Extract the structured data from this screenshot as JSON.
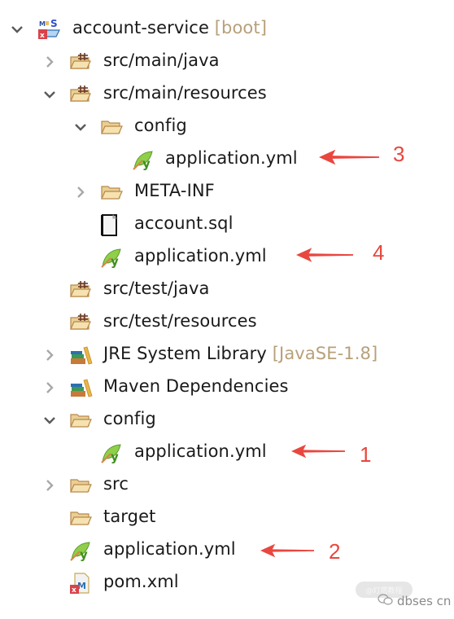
{
  "tree": {
    "root": {
      "label": "account-service",
      "decoration": "[boot]",
      "expanded": true,
      "icon": "maven-spring-project-icon"
    },
    "items": [
      {
        "label": "src/main/java",
        "icon": "package-folder-icon",
        "expandable": true,
        "expanded": false
      },
      {
        "label": "src/main/resources",
        "icon": "package-folder-icon",
        "expandable": true,
        "expanded": true
      },
      {
        "label": "config",
        "icon": "folder-open-icon",
        "expandable": true,
        "expanded": true
      },
      {
        "label": "application.yml",
        "icon": "spring-yaml-icon"
      },
      {
        "label": "META-INF",
        "icon": "folder-open-icon",
        "expandable": true,
        "expanded": false
      },
      {
        "label": "account.sql",
        "icon": "text-file-icon"
      },
      {
        "label": "application.yml",
        "icon": "spring-yaml-icon"
      },
      {
        "label": "src/test/java",
        "icon": "package-folder-icon"
      },
      {
        "label": "src/test/resources",
        "icon": "package-folder-icon"
      },
      {
        "label": "JRE System Library",
        "decoration": "[JavaSE-1.8]",
        "icon": "library-icon",
        "expandable": true,
        "expanded": false
      },
      {
        "label": "Maven Dependencies",
        "icon": "library-icon",
        "expandable": true,
        "expanded": false
      },
      {
        "label": "config",
        "icon": "folder-open-icon",
        "expandable": true,
        "expanded": true
      },
      {
        "label": "application.yml",
        "icon": "spring-yaml-icon"
      },
      {
        "label": "src",
        "icon": "folder-open-icon",
        "expandable": true,
        "expanded": false
      },
      {
        "label": "target",
        "icon": "folder-open-icon"
      },
      {
        "label": "application.yml",
        "icon": "spring-yaml-icon"
      },
      {
        "label": "pom.xml",
        "icon": "maven-pom-icon"
      }
    ]
  },
  "annotations": [
    {
      "number": "3",
      "target": "config/application.yml (src/main/resources)"
    },
    {
      "number": "4",
      "target": "application.yml (src/main/resources)"
    },
    {
      "number": "1",
      "target": "config/application.yml (project root)"
    },
    {
      "number": "2",
      "target": "application.yml (project root)"
    }
  ],
  "watermark": {
    "badge": "@灯塔教程",
    "text": "dbses cn"
  },
  "colors": {
    "arrow": "#e8473f",
    "decoration": "#b8a07a",
    "text": "#1a1a1a"
  }
}
